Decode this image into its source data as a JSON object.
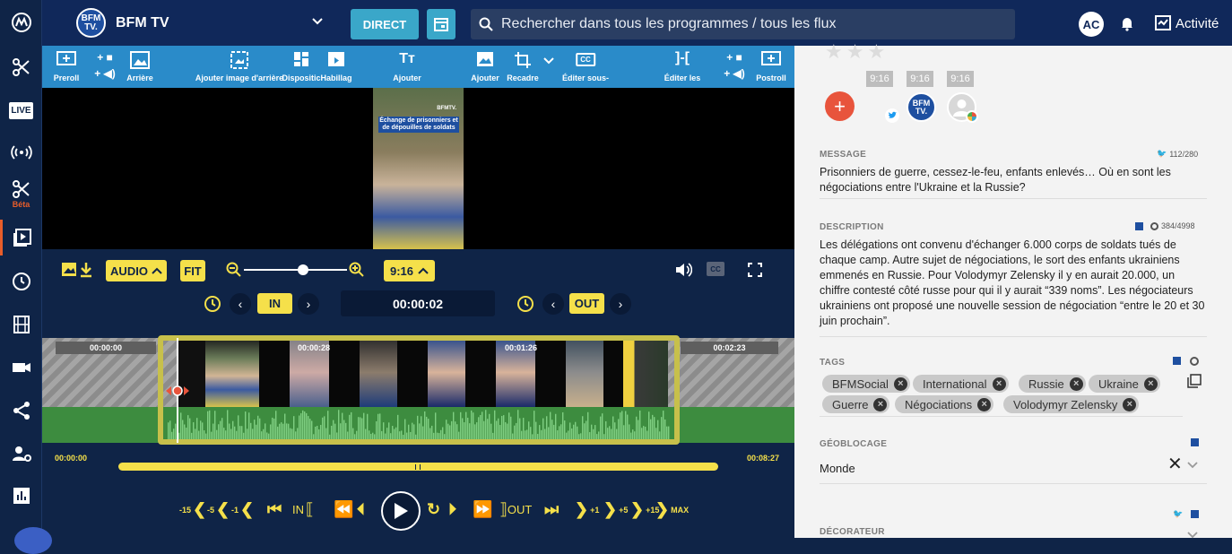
{
  "topbar": {
    "channel_logo": "BFM TV.",
    "channel_name": "BFM TV",
    "direct_label": "DIRECT",
    "search_placeholder": "Rechercher dans tous les programmes / tous les flux",
    "avatar_initials": "AC",
    "activity_label": "Activité"
  },
  "rail": {
    "live_label": "LIVE",
    "beta_label": "Béta"
  },
  "toolbar": {
    "preroll": "Preroll",
    "arriere": "Arrière",
    "ajouter_image": "Ajouter image d'arrière",
    "dispositif": "Dispositic",
    "habillage": "Habillag",
    "ajouter_text": "Ajouter",
    "ajouter_image2": "Ajouter",
    "recadrer": "Recadre",
    "editer_sous": "Éditer sous-",
    "editer_les": "Éditer les",
    "postroll": "Postroll"
  },
  "video": {
    "thumb_brand": "BFMTV.",
    "thumb_title": "Échange de prisonniers et de dépouilles de soldats"
  },
  "controls": {
    "audio_label": "AUDIO",
    "fit_label": "FIT",
    "ratio_label": "9:16",
    "in_label": "IN",
    "out_label": "OUT",
    "timecode": "00:00:02",
    "cc_label": "CC"
  },
  "timeline": {
    "t0": "00:00:00",
    "t1": "00:00:28",
    "t2": "00:01:26",
    "t3": "00:02:23",
    "bar_start": "00:00:00",
    "bar_end": "00:08:27"
  },
  "transport": {
    "m15": "-15",
    "m5": "-5",
    "m1": "-1",
    "in": "IN",
    "out": "OUT",
    "p1": "+1",
    "p5": "+5",
    "p15": "+15",
    "max": "MAX"
  },
  "panel": {
    "ratios": [
      "9:16",
      "9:16",
      "9:16"
    ],
    "message_label": "MESSAGE",
    "message_count": "112/280",
    "message_text": "Prisonniers de guerre, cessez-le-feu, enfants enlevés… Où en sont les négociations entre l'Ukraine et la Russie?",
    "description_label": "DESCRIPTION",
    "description_count": "384/4998",
    "description_text": "Les délégations ont convenu d'échanger 6.000 corps de soldats tués de chaque camp. Autre sujet de négociations, le sort des enfants ukrainiens emmenés en Russie. Pour Volodymyr Zelensky il y en aurait 20.000, un chiffre contesté côté russe pour qui il y  aurait “339 noms”. Les négociateurs ukrainiens ont proposé une nouvelle session de négociation “entre le 20 et 30 juin prochain”.",
    "tags_label": "TAGS",
    "tags": [
      "BFMSocial",
      "International",
      "Russie",
      "Ukraine",
      "Guerre",
      "Négociations",
      "Volodymyr Zelensky"
    ],
    "geo_label": "GÉOBLOCAGE",
    "geo_value": "Monde",
    "decorateur_label": "DÉCORATEUR"
  },
  "colors": {
    "accent_yellow": "#f5e04a",
    "toolbar_blue": "#2a8bc9",
    "navy": "#0f2447",
    "add_red": "#e8543c"
  }
}
